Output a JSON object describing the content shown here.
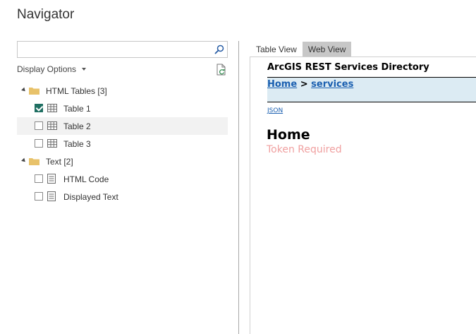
{
  "window": {
    "title": "Navigator"
  },
  "search": {
    "value": "",
    "placeholder": ""
  },
  "display_options": {
    "label": "Display Options"
  },
  "tree": {
    "html_tables": {
      "label": "HTML Tables [3]",
      "items": [
        {
          "label": "Table 1",
          "checked": true
        },
        {
          "label": "Table 2",
          "checked": false,
          "selected": true
        },
        {
          "label": "Table 3",
          "checked": false
        }
      ]
    },
    "text": {
      "label": "Text [2]",
      "items": [
        {
          "label": "HTML Code",
          "checked": false
        },
        {
          "label": "Displayed Text",
          "checked": false
        }
      ]
    }
  },
  "tabs": [
    {
      "label": "Table View",
      "active": true
    },
    {
      "label": "Web View",
      "active": false
    }
  ],
  "preview": {
    "heading": "ArcGIS REST Services Directory",
    "breadcrumb": {
      "home": "Home",
      "separator": ">",
      "services": "services"
    },
    "json_link": "JSON",
    "page_heading": "Home",
    "message": "Token Required"
  },
  "colors": {
    "checkbox_checked": "#1f6f62",
    "link": "#1a5fb0",
    "breadcrumb_bg": "#dcebf3",
    "token_text": "#f0a0a0",
    "folder": "#e8c26a"
  },
  "icons": {
    "search": "search-icon",
    "refresh": "refresh-icon",
    "folder": "folder-icon",
    "table": "table-icon",
    "text": "text-document-icon"
  }
}
